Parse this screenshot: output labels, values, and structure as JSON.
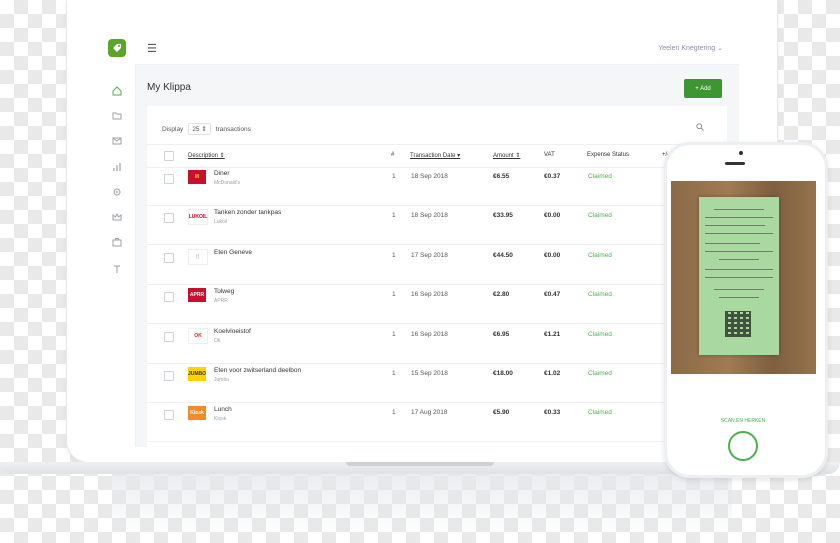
{
  "app": {
    "user_name": "Yeelen Knegtering ⌄",
    "page_title": "My Klippa",
    "add_button": "+ Add"
  },
  "toolbar": {
    "display_label": "Display",
    "page_size": "25 ⇕",
    "transactions_label": "transactions"
  },
  "table": {
    "columns": [
      "Description ⇕",
      "#",
      "Transaction Date ▾",
      "Amount ⇕",
      "VAT",
      "Expense Status",
      "+/-"
    ],
    "rows": [
      {
        "desc": "Diner",
        "merchant": "McDonald's",
        "count": "1",
        "date": "18 Sep 2018",
        "amount": "€6.55",
        "vat": "€0.37",
        "status": "Claimed",
        "logo": "M",
        "logo_color": "#c8102e",
        "logo_text_color": "#ffc72c"
      },
      {
        "desc": "Tanken zonder tankpas",
        "merchant": "Lukoil",
        "count": "1",
        "date": "18 Sep 2018",
        "amount": "€33.95",
        "vat": "€0.00",
        "status": "Claimed",
        "logo": "LUKOIL",
        "logo_color": "#ffffff",
        "logo_text_color": "#d0021b"
      },
      {
        "desc": "Eten Geneve",
        "merchant": "",
        "count": "1",
        "date": "17 Sep 2018",
        "amount": "€44.50",
        "vat": "€0.00",
        "status": "Claimed",
        "logo": "🍴",
        "logo_color": "#ffffff",
        "logo_text_color": "#333333"
      },
      {
        "desc": "Tolweg",
        "merchant": "APRR",
        "count": "1",
        "date": "16 Sep 2018",
        "amount": "€2.80",
        "vat": "€0.47",
        "status": "Claimed",
        "logo": "APRR",
        "logo_color": "#c8102e",
        "logo_text_color": "#ffffff"
      },
      {
        "desc": "Koelvloeistof",
        "merchant": "Ok",
        "count": "1",
        "date": "16 Sep 2018",
        "amount": "€6.95",
        "vat": "€1.21",
        "status": "Claimed",
        "logo": "OK",
        "logo_color": "#ffffff",
        "logo_text_color": "#e41f26"
      },
      {
        "desc": "Eten voor zwitserland deelbon",
        "merchant": "Jumbo",
        "count": "1",
        "date": "15 Sep 2018",
        "amount": "€18.00",
        "vat": "€1.02",
        "status": "Claimed",
        "logo": "JUMBO",
        "logo_color": "#ffd100",
        "logo_text_color": "#333333"
      },
      {
        "desc": "Lunch",
        "merchant": "Kiosk",
        "count": "1",
        "date": "17 Aug 2018",
        "amount": "€5.90",
        "vat": "€0.33",
        "status": "Claimed",
        "logo": "Kiosk",
        "logo_color": "#f28c28",
        "logo_text_color": "#ffffff"
      }
    ]
  },
  "phone": {
    "scan_label": "SCAN EN HERKEN"
  },
  "colors": {
    "accent": "#3d9632",
    "claimed": "#4caf50"
  }
}
